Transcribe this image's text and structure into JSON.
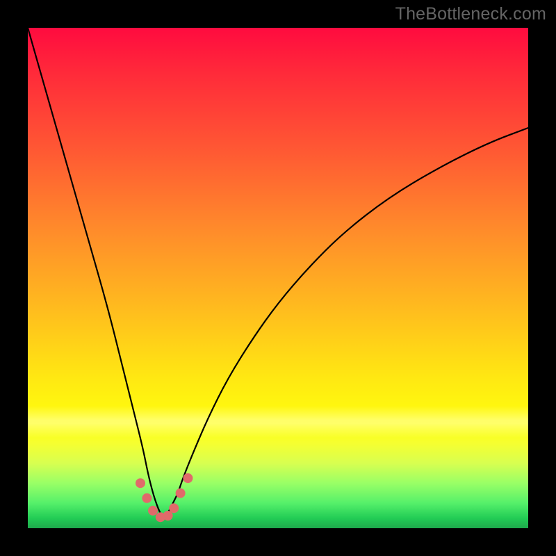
{
  "watermark": {
    "text": "TheBottleneck.com"
  },
  "chart_data": {
    "type": "line",
    "title": "",
    "xlabel": "",
    "ylabel": "",
    "xlim": [
      0,
      100
    ],
    "ylim": [
      0,
      100
    ],
    "grid": false,
    "note": "Bottleneck-style V-curve on a vertical heat gradient. x is normalized parameter (e.g. GPU %), y is bottleneck magnitude (0 = balanced, 100 = severe). Minimum at x≈27.",
    "series": [
      {
        "name": "bottleneck-curve",
        "x": [
          0,
          4,
          8,
          12,
          16,
          19,
          21,
          23,
          24,
          25,
          26,
          27,
          28,
          29,
          30,
          31,
          33,
          36,
          40,
          45,
          50,
          56,
          63,
          72,
          82,
          92,
          100
        ],
        "y": [
          100,
          86,
          72,
          58,
          44,
          32,
          24,
          16,
          11,
          7,
          4,
          2,
          3,
          5,
          7,
          10,
          15,
          22,
          30,
          38,
          45,
          52,
          59,
          66,
          72,
          77,
          80
        ]
      }
    ],
    "markers": {
      "name": "near-minimum-dots",
      "color": "#e06a6a",
      "points": [
        {
          "x": 22.5,
          "y": 9
        },
        {
          "x": 23.8,
          "y": 6
        },
        {
          "x": 25.0,
          "y": 3.5
        },
        {
          "x": 26.5,
          "y": 2.2
        },
        {
          "x": 28.0,
          "y": 2.5
        },
        {
          "x": 29.2,
          "y": 4
        },
        {
          "x": 30.5,
          "y": 7
        },
        {
          "x": 32.0,
          "y": 10
        }
      ]
    },
    "gradient_stops": [
      {
        "pos": 0.0,
        "color": "#ff0b3f"
      },
      {
        "pos": 0.25,
        "color": "#ff5a33"
      },
      {
        "pos": 0.55,
        "color": "#ffb81f"
      },
      {
        "pos": 0.79,
        "color": "#ffff0d"
      },
      {
        "pos": 0.91,
        "color": "#99ff66"
      },
      {
        "pos": 1.0,
        "color": "#1ea84c"
      }
    ]
  }
}
